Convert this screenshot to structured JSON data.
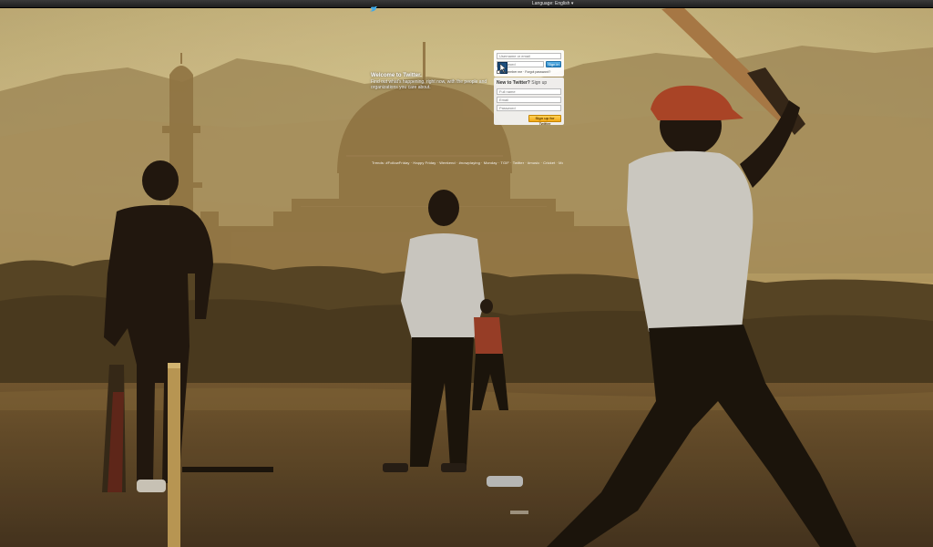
{
  "topbar": {
    "language_label": "Language: English ▾"
  },
  "welcome": {
    "title": "Welcome to Twitter.",
    "subtitle": "Find out what's happening, right now, with the people and organizations you care about."
  },
  "trends": {
    "text": "Trends: #FollowFriday · Happy Friday · Weekend · #nowplaying · Monday · TGIF · Twitter · #music · Cricket · Movie"
  },
  "signin": {
    "username_placeholder": "Username or email",
    "password_placeholder": "Password",
    "signin_button": "Sign in",
    "remember_label": "Remember me · Forgot password?"
  },
  "signup": {
    "heading": "New to Twitter?",
    "heading_suffix": "Sign up",
    "fullname_placeholder": "Full name",
    "email_placeholder": "Email",
    "password_placeholder": "Password",
    "signup_button": "Sign up for Twitter"
  },
  "colors": {
    "topbar": "#1e1e1e",
    "signin_button": "#2a86c4",
    "signup_button": "#f3a915",
    "sky": "#d8c38a",
    "ground": "#6b5530"
  },
  "icons": {
    "logo": "twitter-bird-icon",
    "cursor": "mouse-pointer-icon"
  }
}
